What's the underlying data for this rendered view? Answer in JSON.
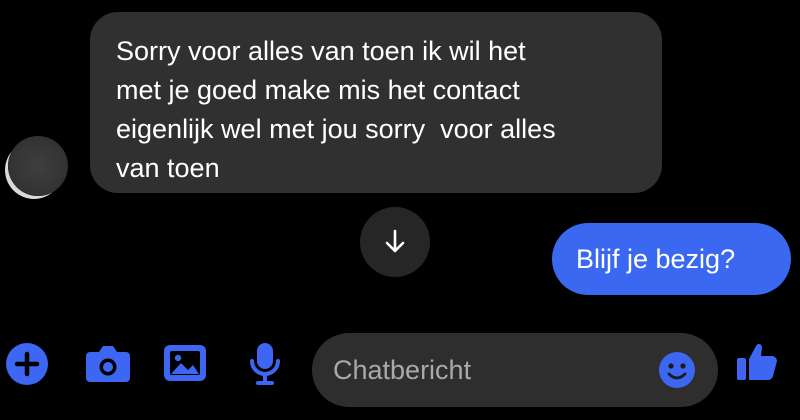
{
  "conversation": {
    "incoming_message": {
      "lines": [
        "Sorry voor alles van toen ik wil het",
        "met je goed make mis het contact",
        "eigenlijk wel met jou sorry  voor alles",
        "van toen"
      ]
    },
    "outgoing_message": {
      "text": "Blijf je bezig?"
    },
    "scroll_button_icon": "arrow-down-icon"
  },
  "composer": {
    "placeholder": "Chatbericht",
    "icons": {
      "add": "plus-icon",
      "camera": "camera-icon",
      "gallery": "image-icon",
      "voice": "microphone-icon",
      "emoji": "smiley-icon",
      "like": "thumbs-up-icon"
    }
  },
  "colors": {
    "background": "#000000",
    "incoming_bubble": "#303030",
    "outgoing_bubble": "#3b68f0",
    "accent": "#3d66f3",
    "input_background": "#2e2e2e",
    "placeholder_text": "#a9a9a9"
  }
}
